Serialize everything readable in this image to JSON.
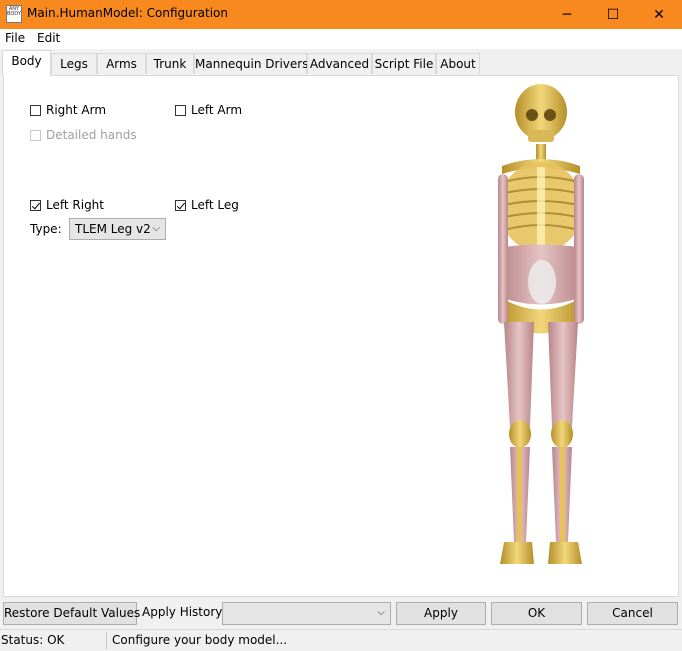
{
  "window": {
    "title": "Main.HumanModel: Configuration",
    "icon_text": "ANY BODY",
    "controls": {
      "minimize": "─",
      "maximize": "☐",
      "close": "✕"
    }
  },
  "menu": {
    "items": [
      "File",
      "Edit"
    ]
  },
  "tabs": [
    "Body",
    "Legs",
    "Arms",
    "Trunk",
    "Mannequin Drivers",
    "Advanced",
    "Script File",
    "About"
  ],
  "active_tab": "Body",
  "body_tab": {
    "right_arm": {
      "label": "Right Arm",
      "checked": false
    },
    "left_arm": {
      "label": "Left Arm",
      "checked": false
    },
    "detailed_hands": {
      "label": "Detailed hands",
      "checked": false,
      "disabled": true
    },
    "left_right": {
      "label": "Left Right",
      "checked": true
    },
    "left_leg": {
      "label": "Left Leg",
      "checked": true
    },
    "type_label": "Type:",
    "type_value": "TLEM Leg v2"
  },
  "bottom": {
    "restore_label": "Restore Default Values",
    "apply_history_label": "Apply History:",
    "apply_history_value": "",
    "apply_label": "Apply",
    "ok_label": "OK",
    "cancel_label": "Cancel"
  },
  "status": {
    "state": "Status: OK",
    "message": "Configure your body model..."
  },
  "colors": {
    "titlebar": "#f7891f",
    "bone": "#e3c25a",
    "muscle": "#d9aeb0"
  }
}
